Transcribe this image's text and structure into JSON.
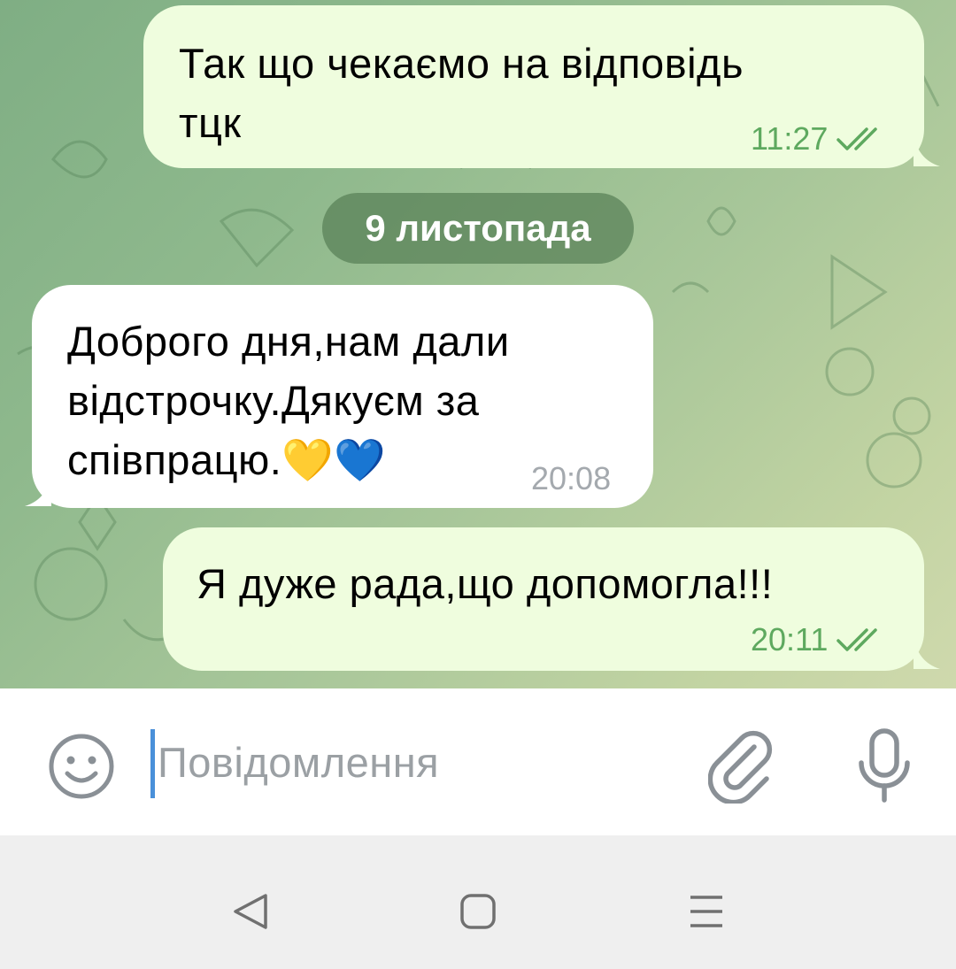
{
  "messages": [
    {
      "direction": "out",
      "lines": [
        "Так що чекаємо на відповідь",
        "тцк"
      ],
      "time": "11:27",
      "status_icon": "double-check-icon"
    },
    {
      "direction": "in",
      "lines": [
        "Доброго дня,нам дали",
        "відстрочку.Дякуєм за",
        "співпрацю.💛💙"
      ],
      "time": "20:08"
    },
    {
      "direction": "out",
      "lines": [
        "Я дуже рада,що допомогла!!!"
      ],
      "time": "20:11",
      "status_icon": "double-check-icon"
    }
  ],
  "date_separator": "9 листопада",
  "composer": {
    "placeholder": "Повідомлення",
    "emoji_icon": "smiley-icon",
    "attach_icon": "paperclip-icon",
    "mic_icon": "microphone-icon"
  },
  "navbar": {
    "back_icon": "triangle-back-icon",
    "home_icon": "square-home-icon",
    "menu_icon": "menu-lines-icon"
  },
  "colors": {
    "outgoing_bubble": "#effdde",
    "incoming_bubble": "#ffffff",
    "check_color": "#5ea95f",
    "date_pill": "#6f9a6c",
    "cursor": "#4a90d9"
  }
}
